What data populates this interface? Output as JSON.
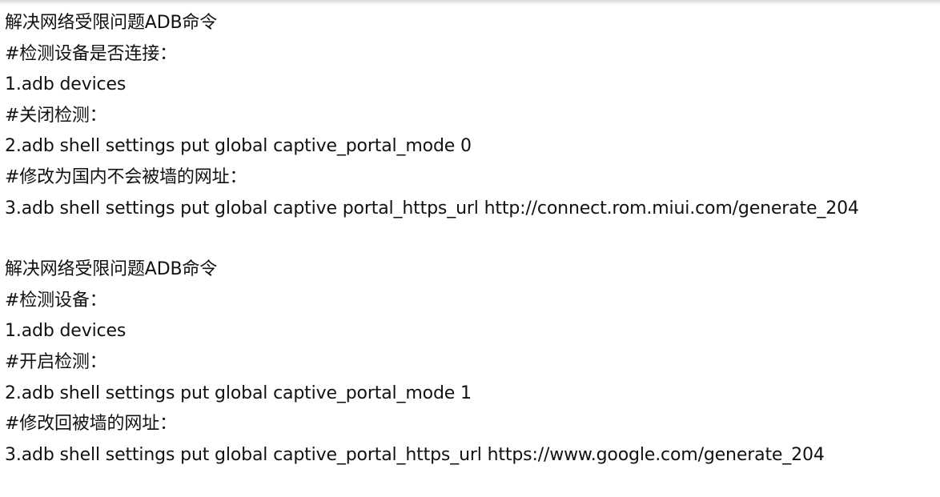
{
  "blocks": [
    {
      "lines": [
        "解决网络受限问题ADB命令",
        "#检测设备是否连接：",
        "1.adb devices",
        "#关闭检测：",
        "2.adb shell settings put global captive_portal_mode 0",
        "#修改为国内不会被墙的网址：",
        "3.adb shell settings put global captive portal_https_url http://connect.rom.miui.com/generate_204"
      ]
    },
    {
      "lines": [
        "解决网络受限问题ADB命令",
        "#检测设备：",
        "1.adb devices",
        "#开启检测：",
        "2.adb shell settings put global captive_portal_mode 1",
        "#修改回被墙的网址：",
        "3.adb shell settings put global captive_portal_https_url https://www.google.com/generate_204"
      ]
    }
  ]
}
